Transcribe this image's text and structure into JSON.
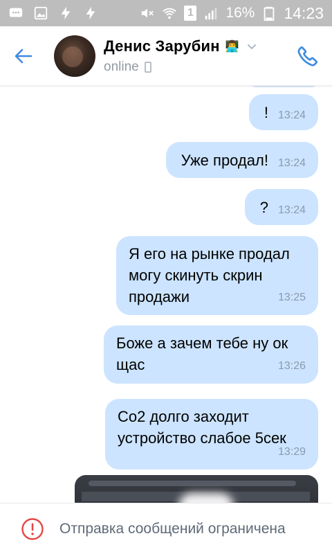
{
  "status_bar": {
    "battery_percent": "16%",
    "time": "14:23",
    "sim_indicator": "1",
    "icons": [
      "message-icon",
      "image-icon",
      "flash-icon",
      "flash-icon",
      "mute-icon",
      "wifi-icon",
      "sim-icon",
      "signal-icon",
      "battery-icon"
    ]
  },
  "header": {
    "contact_name": "Денис Зарубин",
    "name_emoji": "👨‍💻",
    "status": "online"
  },
  "messages": [
    {
      "text": "!",
      "time": "13:24"
    },
    {
      "text": "Уже продал!",
      "time": "13:24"
    },
    {
      "text": "?",
      "time": "13:24"
    },
    {
      "lines": [
        "Я его на рынке продал",
        "могу скинуть скрин",
        "продажи"
      ],
      "time": "13:25"
    },
    {
      "lines": [
        "Боже а зачем тебе ну ок",
        "щас"
      ],
      "time": "13:26"
    },
    {
      "lines": [
        "Со2 долго заходит",
        "устройство слабое 5сек"
      ],
      "time": "13:29"
    }
  ],
  "footer": {
    "notice": "Отправка сообщений ограничена"
  },
  "colors": {
    "accent": "#3f8ae0",
    "bubble": "#cce4ff",
    "warning": "#e64646",
    "status_bar": "#bdbdbd"
  }
}
